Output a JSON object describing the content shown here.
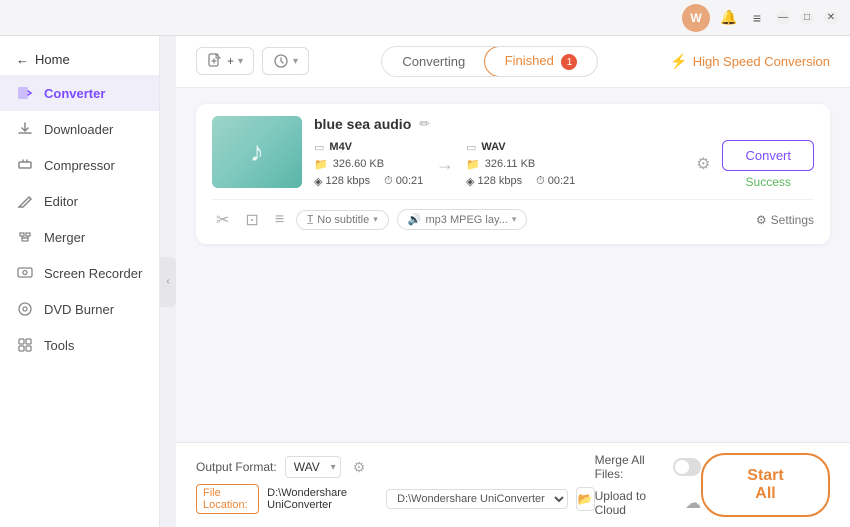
{
  "titleBar": {
    "profileInitial": "W",
    "windowControls": [
      "minimize",
      "maximize",
      "close"
    ]
  },
  "sidebar": {
    "backLabel": "Home",
    "items": [
      {
        "id": "converter",
        "label": "Converter",
        "active": true
      },
      {
        "id": "downloader",
        "label": "Downloader",
        "active": false
      },
      {
        "id": "compressor",
        "label": "Compressor",
        "active": false
      },
      {
        "id": "editor",
        "label": "Editor",
        "active": false
      },
      {
        "id": "merger",
        "label": "Merger",
        "active": false
      },
      {
        "id": "screen-recorder",
        "label": "Screen Recorder",
        "active": false
      },
      {
        "id": "dvd-burner",
        "label": "DVD Burner",
        "active": false
      },
      {
        "id": "tools",
        "label": "Tools",
        "active": false
      }
    ]
  },
  "toolbar": {
    "addFileLabel": "Add Files",
    "tabs": {
      "converting": "Converting",
      "finished": "Finished",
      "finishedBadge": "1"
    },
    "highSpeed": "High Speed Conversion"
  },
  "fileCard": {
    "thumbnail": "music-note",
    "fileName": "blue sea audio",
    "sourceFormat": "M4V",
    "sourceBitrate": "128 kbps",
    "sourceSize": "326.60 KB",
    "sourceDuration": "00:21",
    "targetFormat": "WAV",
    "targetBitrate": "128 kbps",
    "targetSize": "326.11 KB",
    "targetDuration": "00:21",
    "convertBtnLabel": "Convert",
    "successLabel": "Success",
    "subtitleLabel": "No subtitle",
    "audioLabel": "mp3 MPEG lay...",
    "settingsLabel": "Settings"
  },
  "bottomBar": {
    "outputFormatLabel": "Output Format:",
    "outputFormatValue": "WAV",
    "mergeAllLabel": "Merge All Files:",
    "uploadToCloudLabel": "Upload to Cloud",
    "fileLocationLabel": "File Location:",
    "fileLocationPath": "D:\\Wondershare UniConverter",
    "startAllLabel": "Start All"
  }
}
